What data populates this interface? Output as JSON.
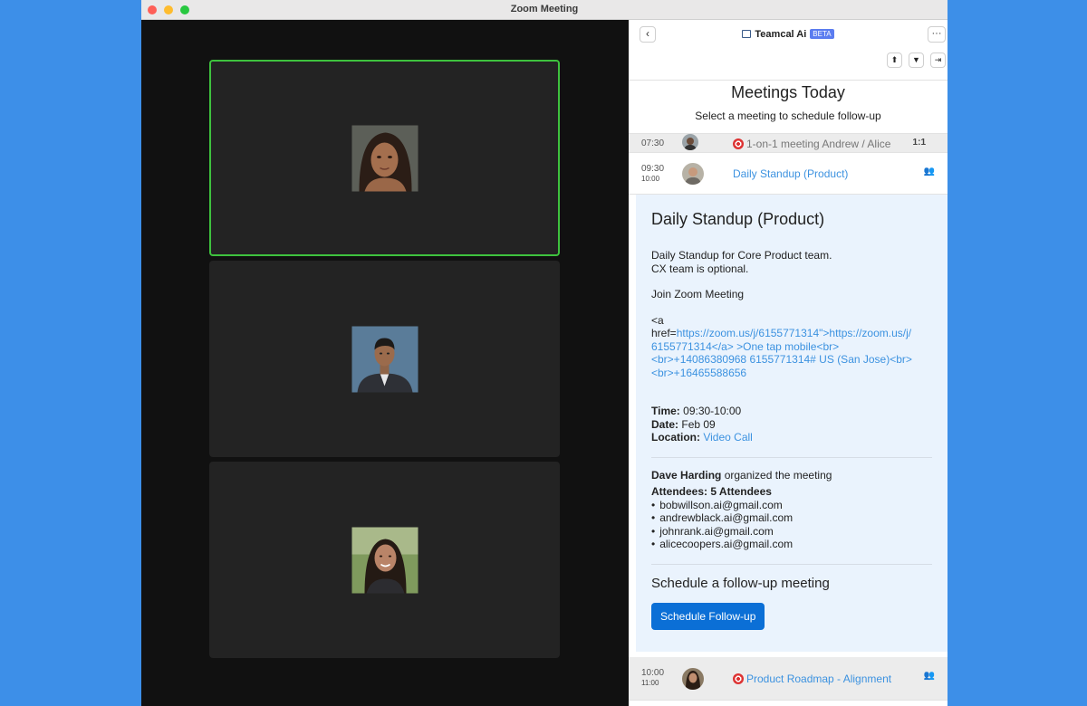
{
  "window": {
    "title": "Zoom Meeting"
  },
  "panel": {
    "back_icon": "‹",
    "brand": "Teamcal Ai",
    "beta": "BETA",
    "more_icon": "···",
    "heading": "Meetings Today",
    "subheading": "Select a meeting to schedule follow-up"
  },
  "meetings": [
    {
      "time": "07:30",
      "title": "1-on-1 meeting Andrew / Alice",
      "badge": "1:1"
    },
    {
      "time": "09:30",
      "end": "10:00",
      "title": "Daily Standup (Product)"
    },
    {
      "time": "10:00",
      "end": "11:00",
      "title": "Product Roadmap - Alignment"
    }
  ],
  "detail": {
    "title": "Daily Standup (Product)",
    "desc1": "Daily Standup for Core Product team.",
    "desc2": "CX team is optional.",
    "join": "Join Zoom Meeting",
    "href_open": "<a",
    "href_prefix": "href=",
    "href_l1": "https://zoom.us/j/6155771314\">https://zoom.us/j/",
    "href_l2": "6155771314</a> >One tap mobile<br>",
    "href_l3": "<br>+14086380968 6155771314# US (San Jose)<br>",
    "href_l4": "<br>+16465588656",
    "time_label": "Time:",
    "time_value": "09:30-10:00",
    "date_label": "Date:",
    "date_value": "Feb 09",
    "location_label": "Location:",
    "location_value": "Video Call",
    "organizer": "Dave Harding",
    "organized_text": "organized the meeting",
    "attendees_label": "Attendees: 5 Attendees",
    "attendees": [
      "bobwillson.ai@gmail.com",
      "andrewblack.ai@gmail.com",
      "johnrank.ai@gmail.com",
      "alicecoopers.ai@gmail.com"
    ],
    "schedule_title": "Schedule a follow-up meeting",
    "schedule_button": "Schedule Follow-up"
  }
}
